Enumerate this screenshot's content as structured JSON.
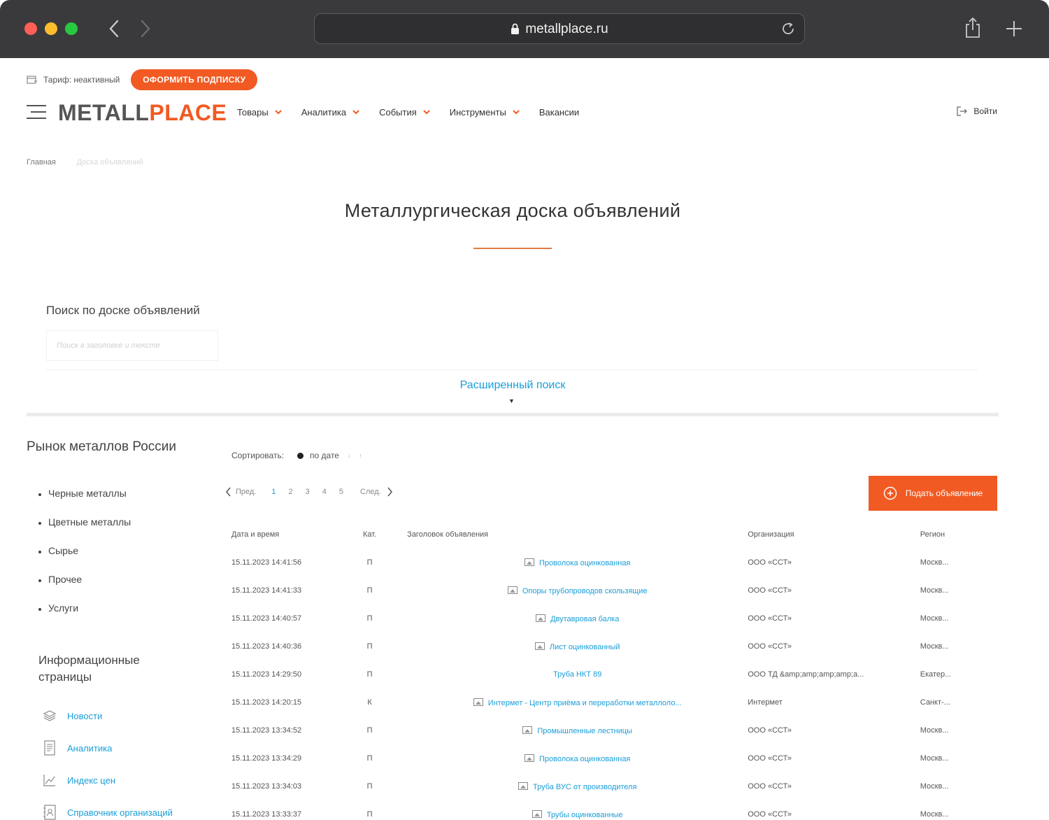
{
  "browser": {
    "url": "metallplace.ru"
  },
  "topbar": {
    "tariff": "Тариф: неактивный",
    "subscribe_label": "ОФОРМИТЬ ПОДПИСКУ"
  },
  "header": {
    "logo_a": "METALL",
    "logo_b": "PLACE",
    "menu": [
      "Товары",
      "Аналитика",
      "События",
      "Инструменты",
      "Вакансии"
    ],
    "login": "Войти"
  },
  "breadcrumb": {
    "home": "Главная",
    "current": "Доска объявлений"
  },
  "page": {
    "title": "Металлургическая доска объявлений"
  },
  "search": {
    "label": "Поиск по доске объявлений",
    "placeholder": "Поиск в заголовке и тексте",
    "advanced": "Расширенный поиск"
  },
  "sidebar": {
    "title": "Рынок металлов России",
    "categories": [
      "Черные металлы",
      "Цветные металлы",
      "Сырье",
      "Прочее",
      "Услуги"
    ],
    "info_title": "Информационные страницы",
    "info_links": [
      "Новости",
      "Аналитика",
      "Индекс цен",
      "Справочник организаций"
    ]
  },
  "sort": {
    "label": "Сортировать:",
    "by_date": "по дате"
  },
  "pager": {
    "prev": "Пред.",
    "pages": [
      "1",
      "2",
      "3",
      "4",
      "5"
    ],
    "next": "След."
  },
  "post_button": "Подать объявление",
  "table": {
    "headers": {
      "date": "Дата и время",
      "cat": "Кат.",
      "title": "Заголовок объявления",
      "org": "Организация",
      "region": "Регион"
    },
    "rows": [
      {
        "date": "15.11.2023 14:41:56",
        "cat": "П",
        "title": "Проволока оцинкованная",
        "img": true,
        "org": "ООО «ССТ»",
        "region": "Москв..."
      },
      {
        "date": "15.11.2023 14:41:33",
        "cat": "П",
        "title": "Опоры трубопроводов скользящие",
        "img": true,
        "org": "ООО «ССТ»",
        "region": "Москв..."
      },
      {
        "date": "15.11.2023 14:40:57",
        "cat": "П",
        "title": "Двутавровая балка",
        "img": true,
        "org": "ООО «ССТ»",
        "region": "Москв..."
      },
      {
        "date": "15.11.2023 14:40:36",
        "cat": "П",
        "title": "Лист оцинкованный",
        "img": true,
        "org": "ООО «ССТ»",
        "region": "Москв..."
      },
      {
        "date": "15.11.2023 14:29:50",
        "cat": "П",
        "title": "Труба НКТ 89",
        "img": false,
        "org": "ООО ТД &amp;amp;amp;amp;a...",
        "region": "Екатер..."
      },
      {
        "date": "15.11.2023 14:20:15",
        "cat": "К",
        "title": "Интермет - Центр приёма и переработки металлоло...",
        "img": true,
        "org": "Интермет",
        "region": "Санкт-..."
      },
      {
        "date": "15.11.2023 13:34:52",
        "cat": "П",
        "title": "Промышленные лестницы",
        "img": true,
        "org": "ООО «ССТ»",
        "region": "Москв..."
      },
      {
        "date": "15.11.2023 13:34:29",
        "cat": "П",
        "title": "Проволока оцинкованная",
        "img": true,
        "org": "ООО «ССТ»",
        "region": "Москв..."
      },
      {
        "date": "15.11.2023 13:34:03",
        "cat": "П",
        "title": "Труба ВУС от производителя",
        "img": true,
        "org": "ООО «ССТ»",
        "region": "Москв..."
      },
      {
        "date": "15.11.2023 13:33:37",
        "cat": "П",
        "title": "Трубы оцинкованные",
        "img": true,
        "org": "ООО «ССТ»",
        "region": "Москв..."
      }
    ]
  },
  "colors": {
    "accent": "#f15a22",
    "link": "#1a9ed8"
  }
}
